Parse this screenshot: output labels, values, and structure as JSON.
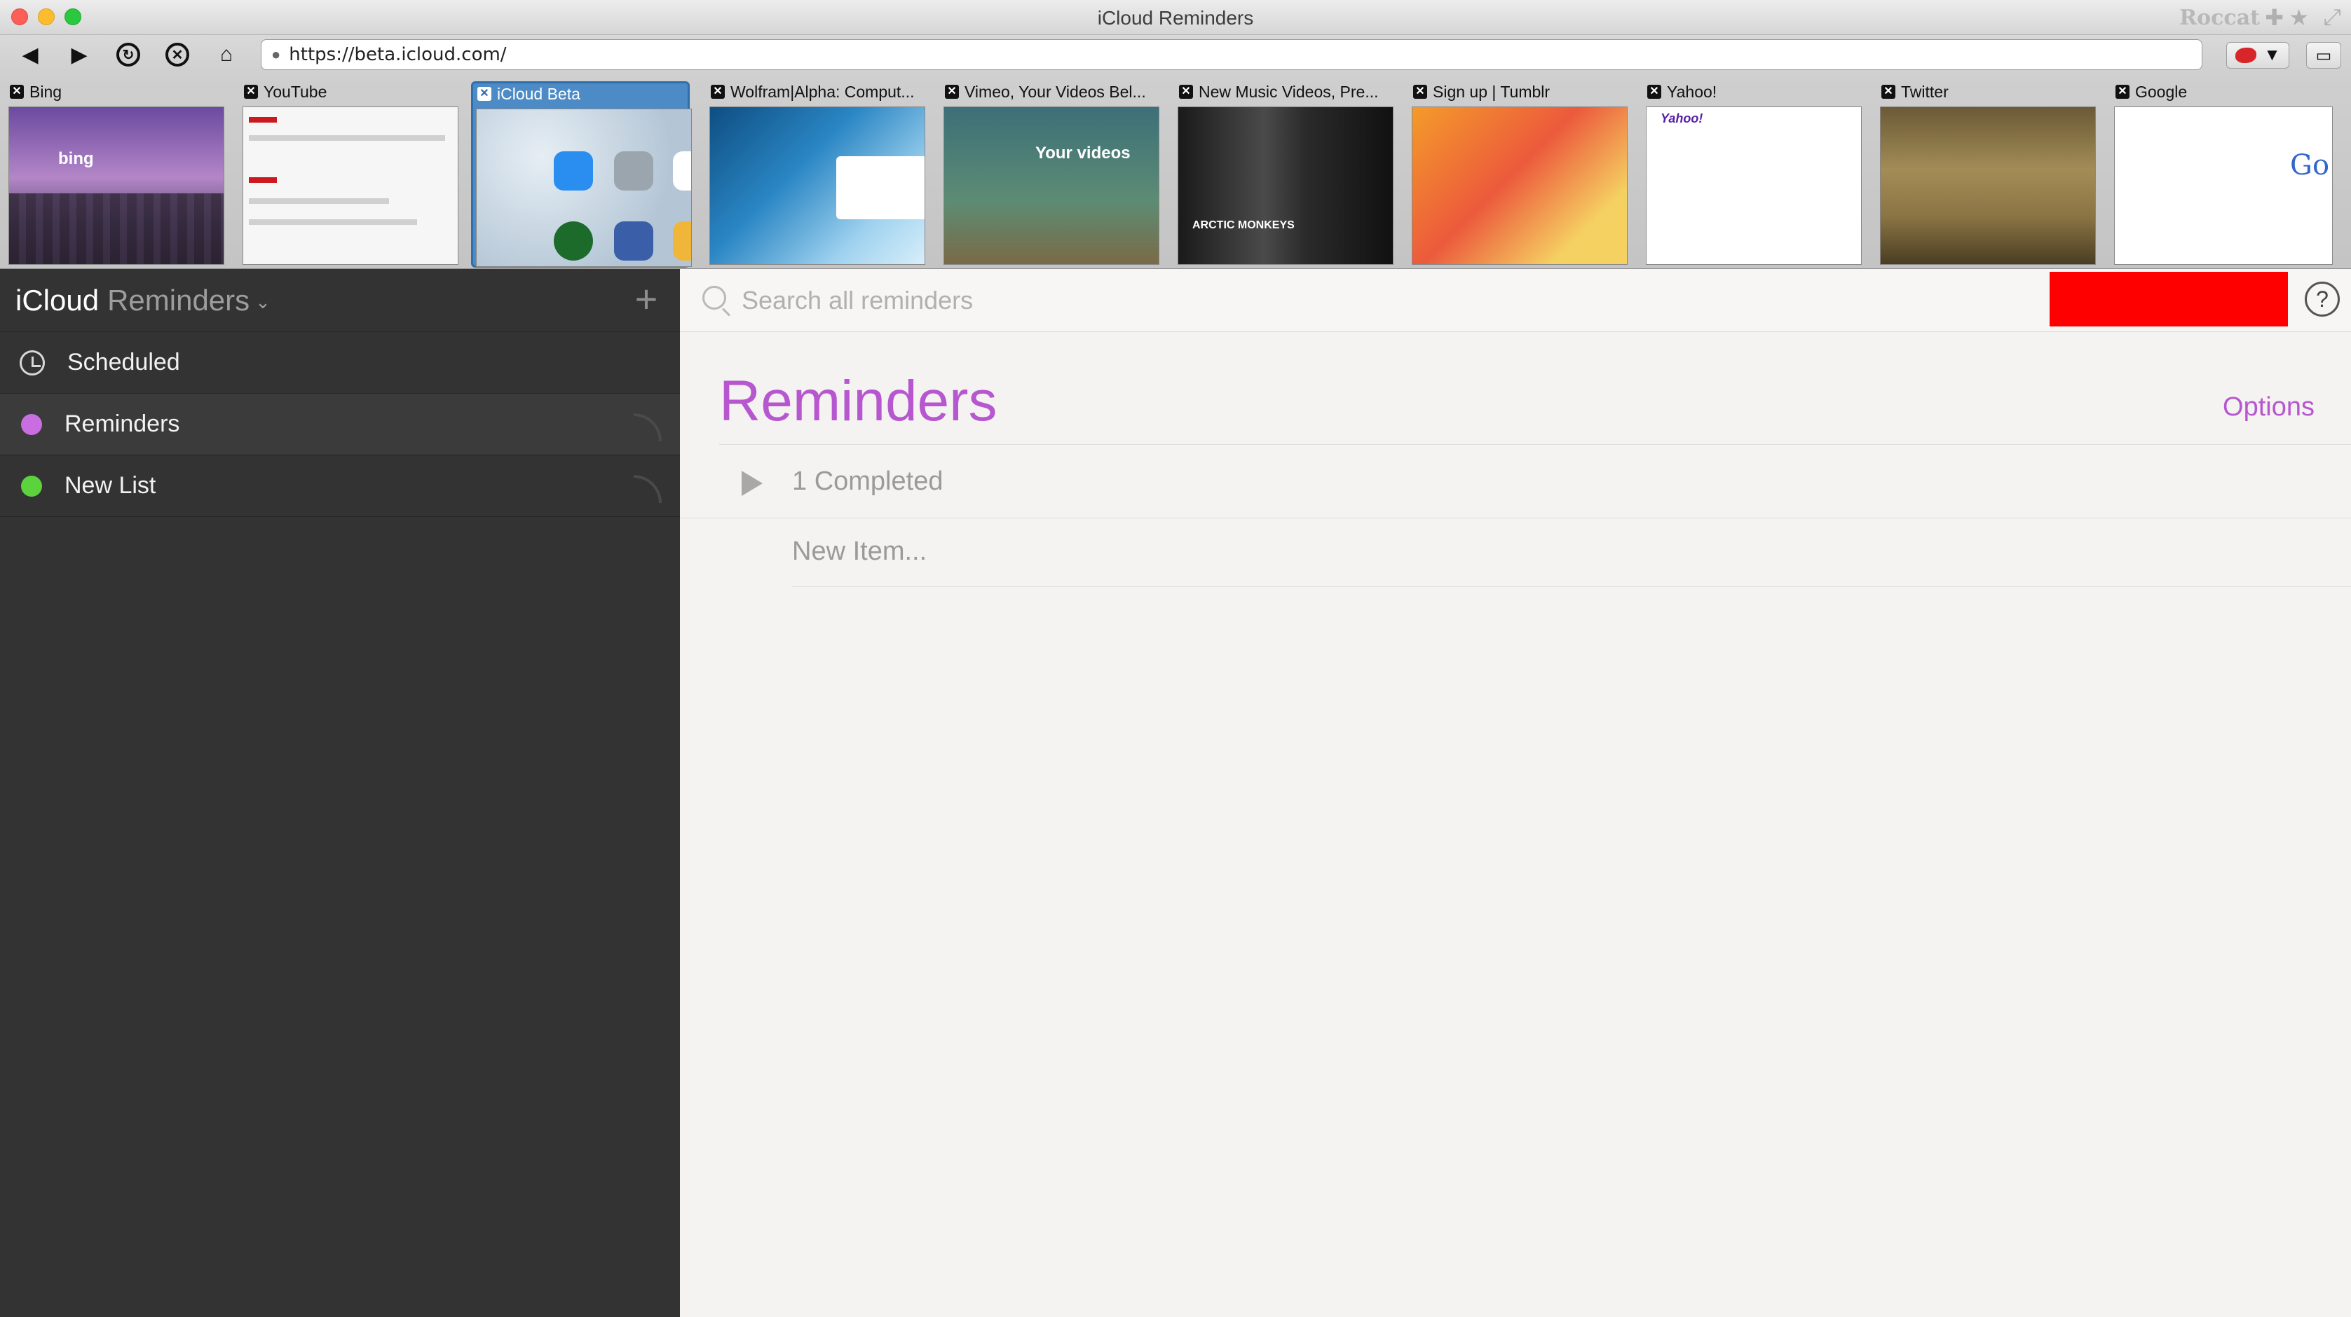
{
  "window": {
    "title": "iCloud Reminders",
    "browser_brand": "Roccat"
  },
  "toolbar": {
    "url": "https://beta.icloud.com/"
  },
  "tabs": [
    {
      "title": "Bing",
      "active": false
    },
    {
      "title": "YouTube",
      "active": false
    },
    {
      "title": "iCloud Beta",
      "active": true
    },
    {
      "title": "Wolfram|Alpha: Comput...",
      "active": false
    },
    {
      "title": "Vimeo, Your Videos Bel...",
      "active": false
    },
    {
      "title": "New Music Videos, Pre...",
      "active": false
    },
    {
      "title": "Sign up | Tumblr",
      "active": false
    },
    {
      "title": "Yahoo!",
      "active": false
    },
    {
      "title": "Twitter",
      "active": false
    },
    {
      "title": "Google",
      "active": false
    }
  ],
  "thumbnails": {
    "bing_logo": "bing",
    "vimeo_text": "Your videos",
    "vevo_text": "ARCTIC MONKEYS",
    "yahoo_logo": "Yahoo!",
    "google_logo": "Go"
  },
  "sidebar": {
    "brand": "iCloud",
    "app_name": "Reminders",
    "items": [
      {
        "label": "Scheduled",
        "icon": "alarm-clock-icon"
      },
      {
        "label": "Reminders",
        "color": "#c86ee0",
        "selected": true
      },
      {
        "label": "New List",
        "color": "#5cd33c",
        "selected": false
      }
    ]
  },
  "main": {
    "search_placeholder": "Search all reminders",
    "list_title": "Reminders",
    "options_label": "Options",
    "completed_label": "1 Completed",
    "new_item_placeholder": "New Item...",
    "accent_color": "#b757d0"
  }
}
